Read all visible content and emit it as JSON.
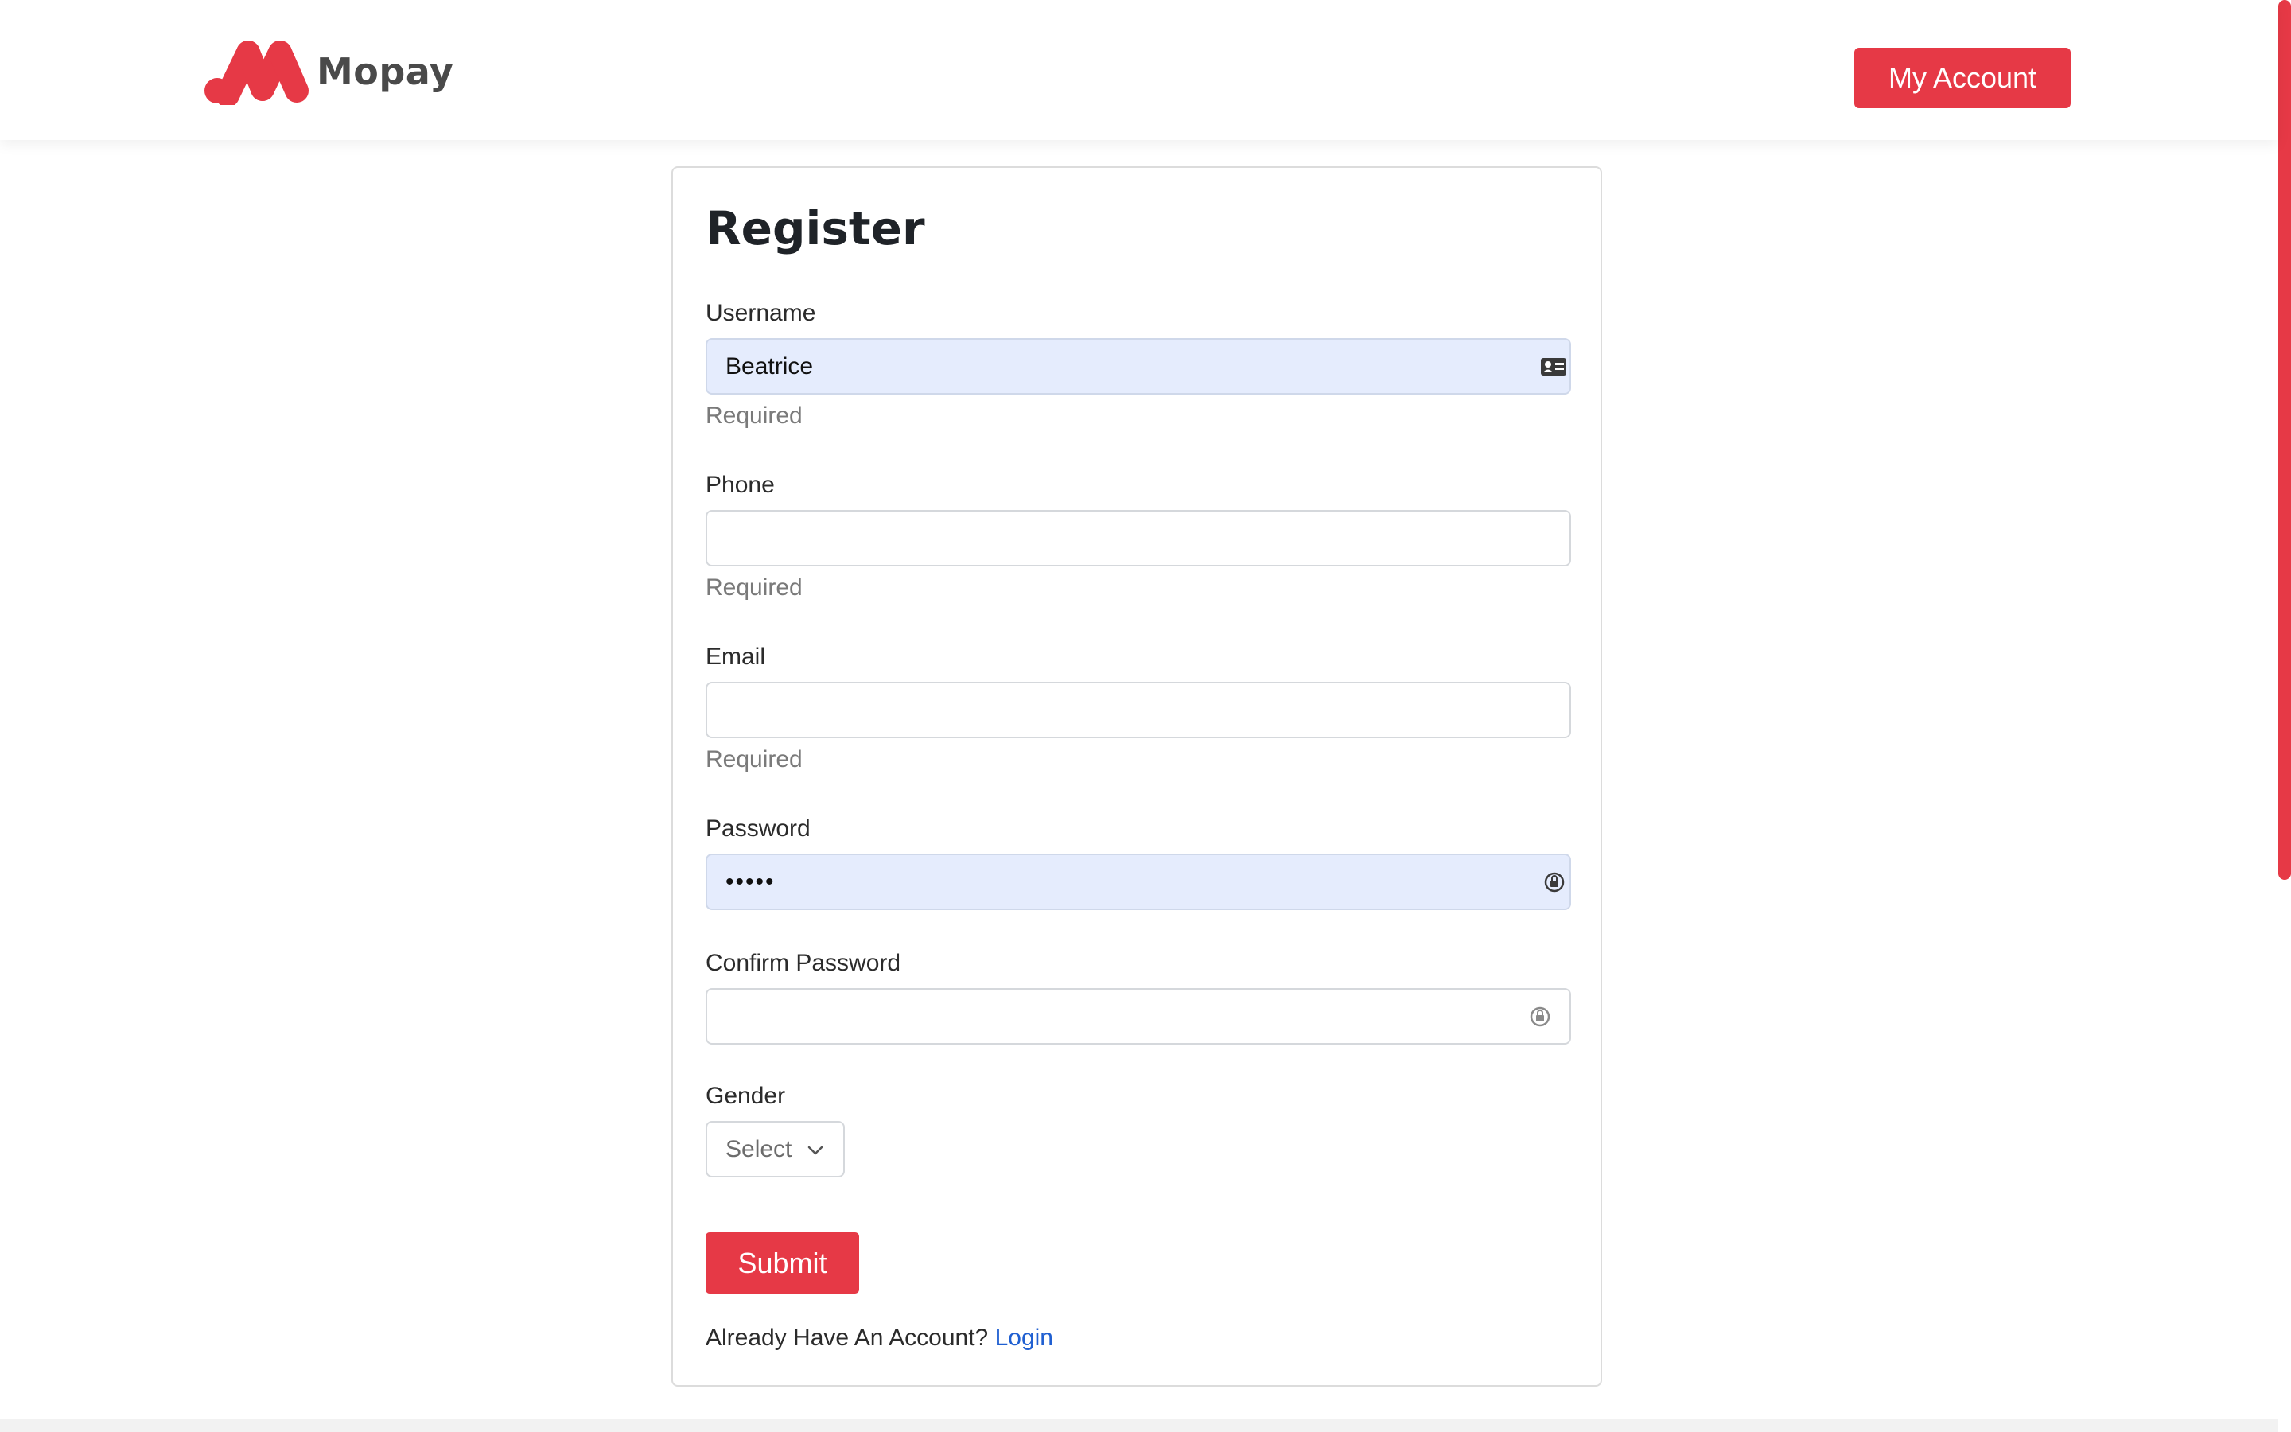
{
  "brand": {
    "name": "Mopay",
    "accent": "#e63946"
  },
  "header": {
    "account_button": "My Account"
  },
  "form": {
    "title": "Register",
    "fields": [
      {
        "label": "Username",
        "value": "Beatrice",
        "help": "Required",
        "icon": "contact-card-icon"
      },
      {
        "label": "Phone",
        "value": "",
        "help": "Required"
      },
      {
        "label": "Email",
        "value": "",
        "help": "Required"
      },
      {
        "label": "Password",
        "value": "•••••",
        "icon": "password-manager-icon"
      },
      {
        "label": "Confirm Password",
        "value": "",
        "icon": "password-manager-icon"
      }
    ],
    "gender": {
      "label": "Gender",
      "selected": "Select",
      "icon": "chevron-down-icon"
    },
    "submit": "Submit",
    "login_prompt": "Already Have An Account?",
    "login_link": "Login"
  }
}
